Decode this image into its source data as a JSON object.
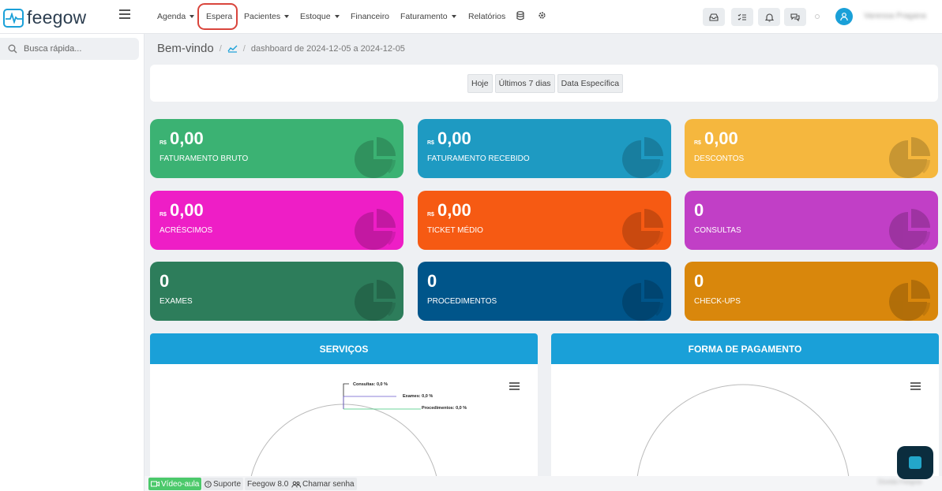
{
  "header": {
    "logo_text": "feegow",
    "nav": [
      {
        "label": "Agenda",
        "caret": true
      },
      {
        "label": "Espera",
        "caret": false
      },
      {
        "label": "Pacientes",
        "caret": true
      },
      {
        "label": "Estoque",
        "caret": true
      },
      {
        "label": "Financeiro",
        "caret": false
      },
      {
        "label": "Faturamento",
        "caret": true
      },
      {
        "label": "Relatórios",
        "caret": false
      }
    ],
    "username": "Vanessa Pragana"
  },
  "sidebar": {
    "search_placeholder": "Busca rápida..."
  },
  "breadcrumb": {
    "title": "Bem-vindo",
    "path": "dashboard de 2024-12-05 a 2024-12-05"
  },
  "filters": {
    "buttons": [
      "Hoje",
      "Últimos 7 dias",
      "Data Específica"
    ]
  },
  "cards": [
    {
      "currency": "R$",
      "value": "0,00",
      "label": "FATURAMENTO BRUTO",
      "color": "#3bb273"
    },
    {
      "currency": "R$",
      "value": "0,00",
      "label": "FATURAMENTO RECEBIDO",
      "color": "#1e9ac2"
    },
    {
      "currency": "R$",
      "value": "0,00",
      "label": "DESCONTOS",
      "color": "#f5b73e"
    },
    {
      "currency": "R$",
      "value": "0,00",
      "label": "ACRÉSCIMOS",
      "color": "#ee1ec6"
    },
    {
      "currency": "R$",
      "value": "0,00",
      "label": "TICKET MÉDIO",
      "color": "#f65a13"
    },
    {
      "currency": "",
      "value": "0",
      "label": "CONSULTAS",
      "color": "#c13fc6"
    },
    {
      "currency": "",
      "value": "0",
      "label": "EXAMES",
      "color": "#2d7d5b"
    },
    {
      "currency": "",
      "value": "0",
      "label": "PROCEDIMENTOS",
      "color": "#00558a"
    },
    {
      "currency": "",
      "value": "0",
      "label": "CHECK-UPS",
      "color": "#d9870c"
    }
  ],
  "panels": {
    "services_title": "SERVIÇOS",
    "payment_title": "FORMA DE PAGAMENTO",
    "services_legend": [
      "Consultas: 0,0 %",
      "Exames: 0,0 %",
      "Procedimentos: 0,0 %"
    ]
  },
  "footer": {
    "video": "Vídeo-aula",
    "support": "Suporte",
    "version": "Feegow 8.0",
    "call": "Chamar senha",
    "right_text": "Dúvida Feegow"
  },
  "colors": {
    "brand": "#1aa0d8",
    "highlight_ring": "#d9453c"
  }
}
